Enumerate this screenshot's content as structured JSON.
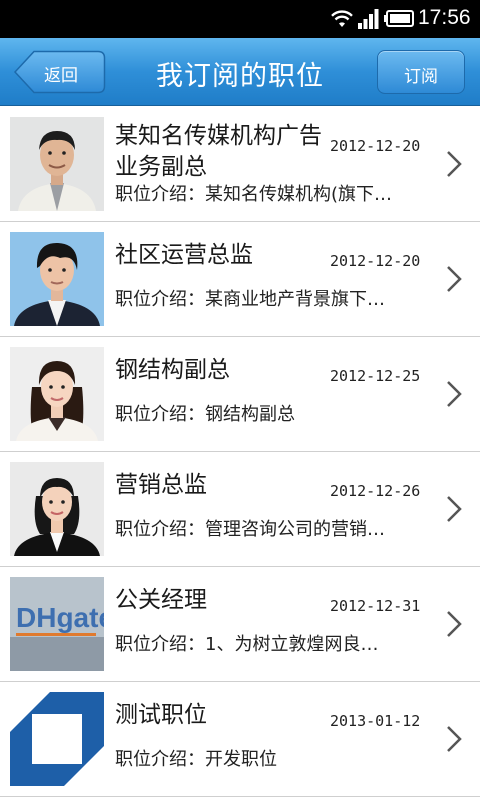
{
  "status_bar": {
    "time": "17:56",
    "icons": [
      "wifi-icon",
      "signal-icon",
      "battery-icon"
    ]
  },
  "header": {
    "back_label": "返回",
    "title": "我订阅的职位",
    "subscribe_label": "订阅"
  },
  "colors": {
    "header_top": "#5fb6ee",
    "header_bottom": "#1f7dc8",
    "divider": "#cfcfcf"
  },
  "jobs": [
    {
      "title": "某知名传媒机构广告业务副总",
      "date": "2012-12-20",
      "desc": "职位介绍：某知名传媒机构(旗下…",
      "thumb": "man-photo"
    },
    {
      "title": "社区运营总监",
      "date": "2012-12-20",
      "desc": "职位介绍：某商业地产背景旗下…",
      "thumb": "young-man-photo"
    },
    {
      "title": "钢结构副总",
      "date": "2012-12-25",
      "desc": "职位介绍：钢结构副总",
      "thumb": "woman-photo"
    },
    {
      "title": "营销总监",
      "date": "2012-12-26",
      "desc": "职位介绍：管理咨询公司的营销…",
      "thumb": "woman-suit-photo"
    },
    {
      "title": "公关经理",
      "date": "2012-12-31",
      "desc": "职位介绍：1、为树立敦煌网良…",
      "thumb": "dhgate-logo",
      "thumb_text": "DHgate"
    },
    {
      "title": "测试职位",
      "date": "2013-01-12",
      "desc": "职位介绍：开发职位",
      "thumb": "blue-square-logo"
    }
  ]
}
